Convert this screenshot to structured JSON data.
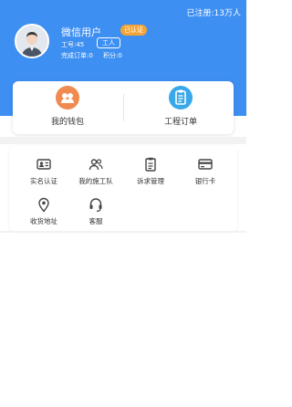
{
  "header": {
    "registered_note": "已注册:13万人",
    "user_name": "微信用户",
    "cert_badge": "已认证",
    "worker_id": "工号:45",
    "worker_badge": "工人",
    "completed_orders": "完成订单:0",
    "points": "积分:0"
  },
  "primary": {
    "wallet_label": "我的钱包",
    "orders_label": "工程订单"
  },
  "services": [
    {
      "label": "实名认证",
      "icon": "id-card-icon"
    },
    {
      "label": "我的施工队",
      "icon": "team-icon"
    },
    {
      "label": "诉求管理",
      "icon": "clipboard-icon"
    },
    {
      "label": "银行卡",
      "icon": "bank-card-icon"
    },
    {
      "label": "收货地址",
      "icon": "location-icon"
    },
    {
      "label": "客服",
      "icon": "headset-icon"
    }
  ],
  "colors": {
    "header_bg": "#3d8ff2",
    "badge_orange": "#f3a436",
    "wallet_icon": "#f08a4e",
    "orders_icon": "#39a8e8"
  }
}
